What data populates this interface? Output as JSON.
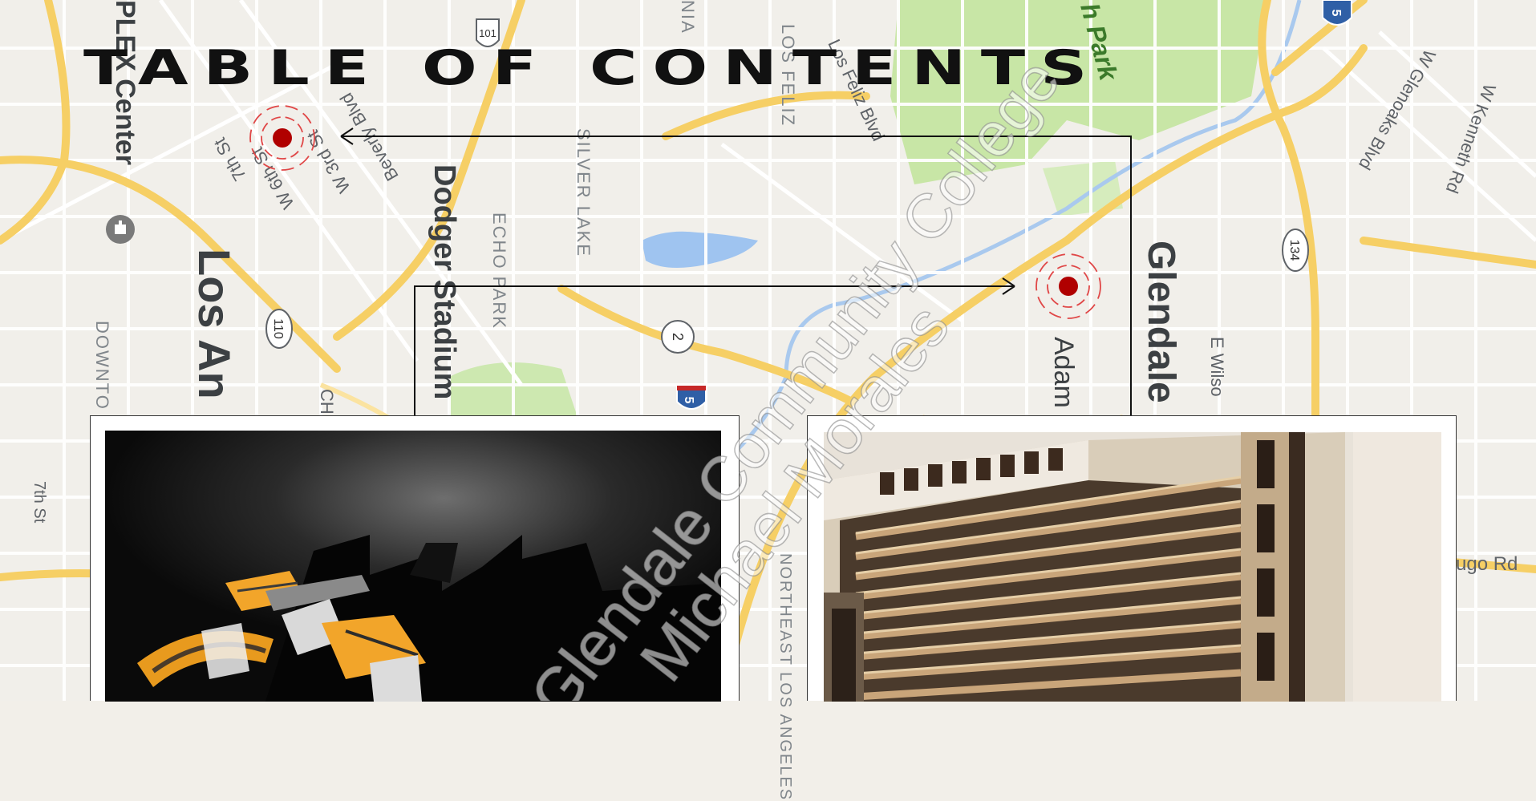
{
  "page": {
    "title": "TABLE OF CONTENTS"
  },
  "map": {
    "labels": {
      "plex_center": "PLEX Center",
      "los_angeles": "Los An",
      "downtown": "DOWNTO",
      "seventh_st_left": "7th St",
      "seventh_st": "7th St",
      "w_6th_st": "W 6th St",
      "w_3rd_st": "W 3rd St",
      "beverly_blvd": "Beverly Blvd",
      "dodger_stadium": "Dodger Stadium",
      "echo_park": "ECHO PARK",
      "silver_lake": "SILVER LAKE",
      "los_feliz": "LOS FELIZ",
      "los_feliz_blvd": "Los Feliz Blvd",
      "griffith_park": "h Park",
      "glendale": "Glendale",
      "adams": "Adam",
      "e_wilson": "E Wilso",
      "w_glenoaks": "W Glenoaks Blvd",
      "w_kenneth": "W Kenneth Rd",
      "hugo_rd": "ugo Rd",
      "northeast_la": "NORTHEAST LOS ANGELES",
      "ch": "CH",
      "nia": "NIA"
    },
    "shields": {
      "us110_top": "101",
      "us110": "110",
      "ca2": "2",
      "i5_bottom": "5",
      "ca134": "134",
      "i5_top": "5"
    }
  },
  "watermark": {
    "line1": "Glendale Community College",
    "line2": "Michael Morales"
  }
}
